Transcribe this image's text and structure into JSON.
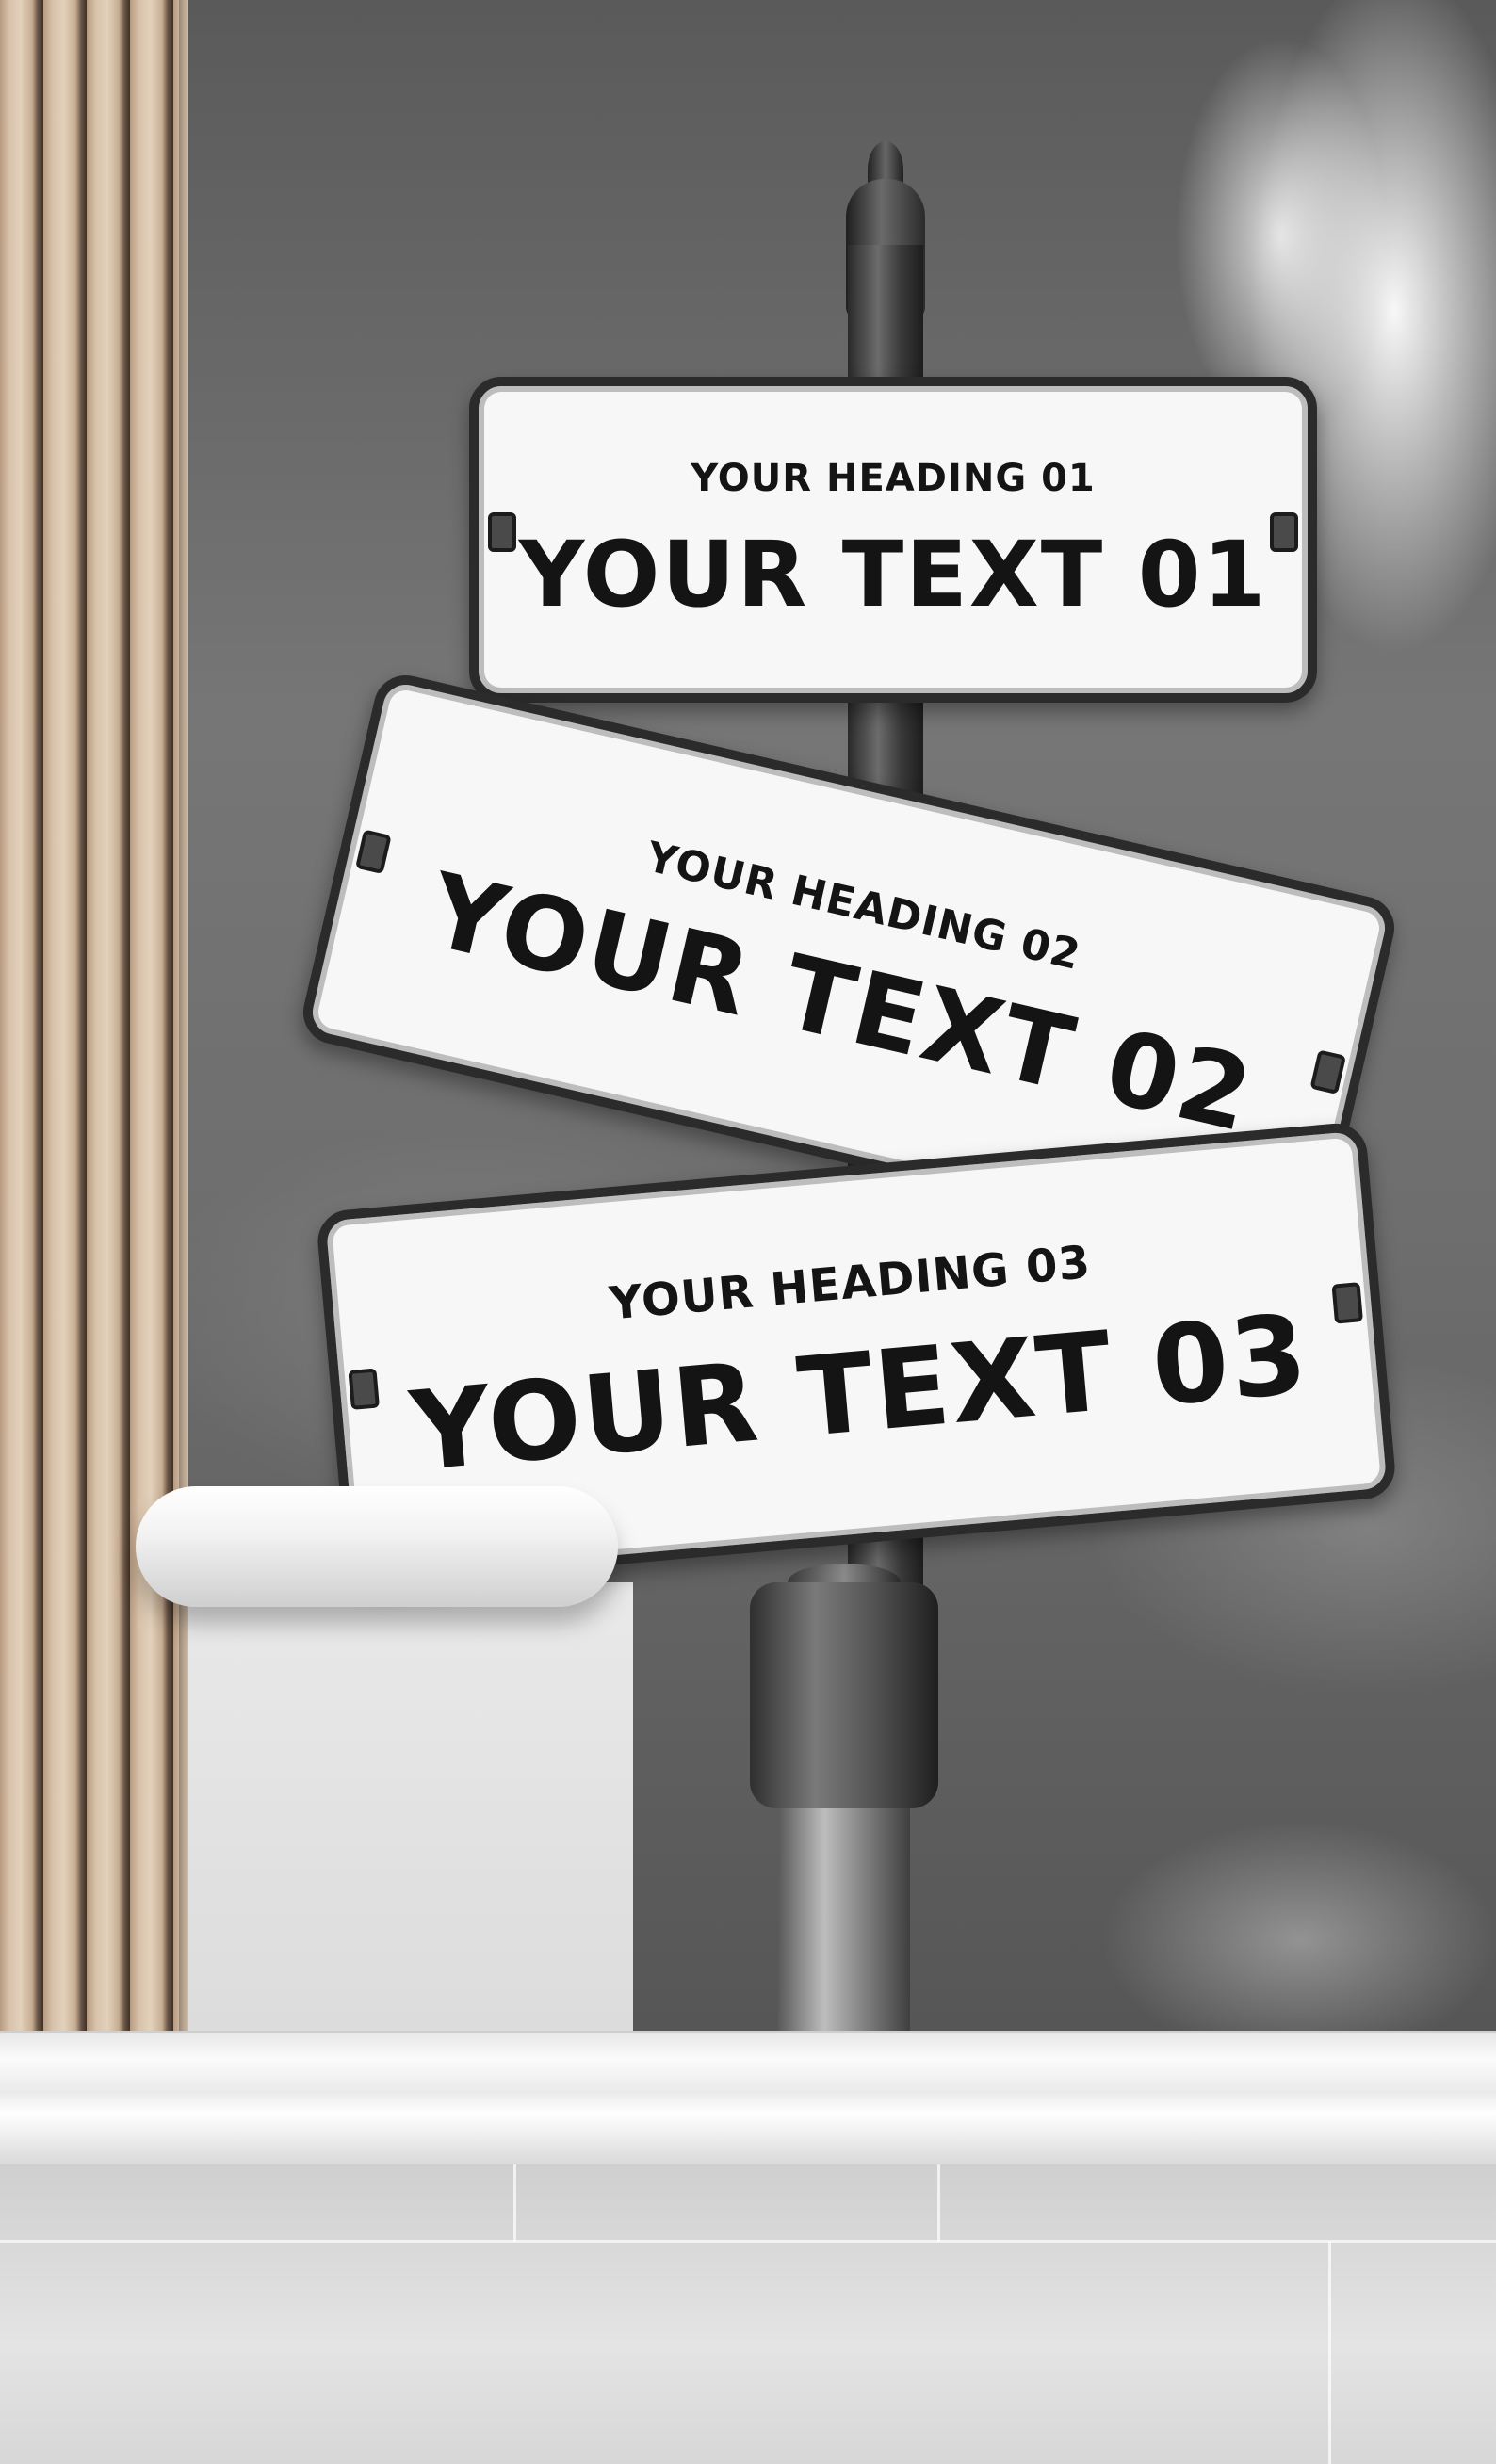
{
  "signs": [
    {
      "heading": "YOUR HEADING 01",
      "text": "YOUR TEXT 01"
    },
    {
      "heading": "YOUR HEADING 02",
      "text": "YOUR TEXT 02"
    },
    {
      "heading": "YOUR HEADING 03",
      "text": "YOUR TEXT 03"
    }
  ],
  "colors": {
    "sign_background": "#f7f7f7",
    "sign_text": "#141414",
    "sign_frame": "#2b2b2b",
    "wood": "#d8c3ab"
  }
}
